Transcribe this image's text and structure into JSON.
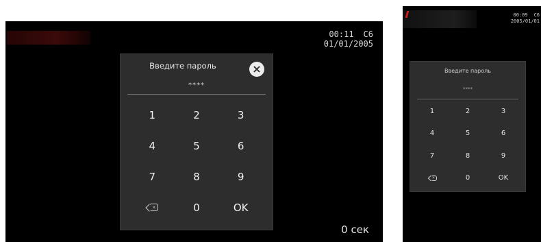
{
  "screen_large": {
    "status": {
      "time": "00:11",
      "channel": "C6",
      "date": "01/01/2005"
    },
    "dialog": {
      "title": "Введите пароль",
      "password_mask": "****",
      "close_icon": "close-icon"
    },
    "keypad": [
      "1",
      "2",
      "3",
      "4",
      "5",
      "6",
      "7",
      "8",
      "9",
      "⌫",
      "0",
      "OK"
    ],
    "countdown": "0 сек"
  },
  "screen_small": {
    "status": {
      "time": "00:09",
      "channel": "C6",
      "date": "2005/01/01"
    },
    "dialog": {
      "title": "Введите пароль",
      "password_mask": "****"
    },
    "keypad": [
      "1",
      "2",
      "3",
      "4",
      "5",
      "6",
      "7",
      "8",
      "9",
      "⌫",
      "0",
      "OK"
    ]
  },
  "colors": {
    "screen_bg": "#000000",
    "dialog_bg": "#2d2d2d",
    "text": "#f2f2f2",
    "close_button": "#ececec"
  }
}
